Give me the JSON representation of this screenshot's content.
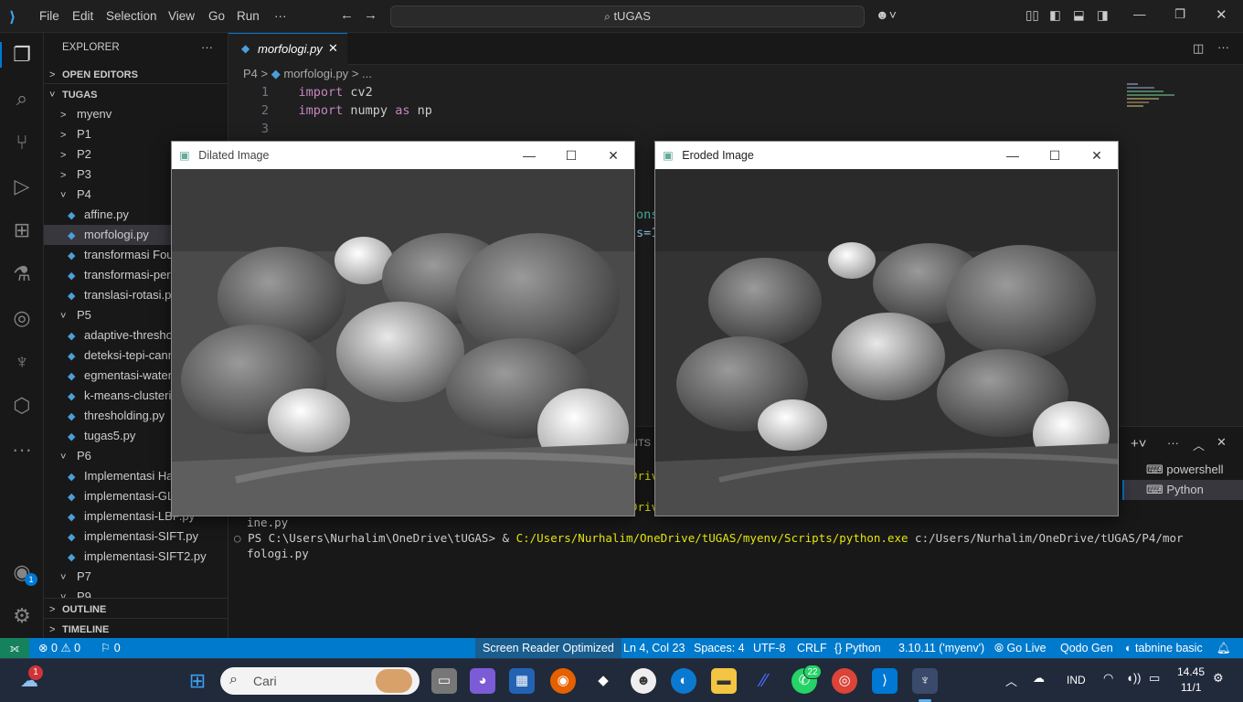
{
  "titlebar": {
    "menu": [
      "File",
      "Edit",
      "Selection",
      "View",
      "Go",
      "Run"
    ],
    "more": "···",
    "search": "tUGAS"
  },
  "sidebar": {
    "title": "EXPLORER",
    "more": "···",
    "open_editors": "OPEN EDITORS",
    "workspace": "TUGAS",
    "tree": [
      {
        "label": "myenv",
        "type": "folder",
        "depth": 1
      },
      {
        "label": "P1",
        "type": "folder",
        "depth": 1
      },
      {
        "label": "P2",
        "type": "folder",
        "depth": 1
      },
      {
        "label": "P3",
        "type": "folder",
        "depth": 1
      },
      {
        "label": "P4",
        "type": "folder-open",
        "depth": 1
      },
      {
        "label": "affine.py",
        "type": "file",
        "depth": 2
      },
      {
        "label": "morfologi.py",
        "type": "file",
        "depth": 2,
        "selected": true
      },
      {
        "label": "transformasi Fourier.py",
        "type": "file",
        "depth": 2
      },
      {
        "label": "transformasi-perspektif.py",
        "type": "file",
        "depth": 2
      },
      {
        "label": "translasi-rotasi.py",
        "type": "file",
        "depth": 2
      },
      {
        "label": "P5",
        "type": "folder-open",
        "depth": 1
      },
      {
        "label": "adaptive-thresholding.py",
        "type": "file",
        "depth": 2
      },
      {
        "label": "deteksi-tepi-canny.py",
        "type": "file",
        "depth": 2
      },
      {
        "label": "egmentasi-watershed.py",
        "type": "file",
        "depth": 2
      },
      {
        "label": "k-means-clustering.py",
        "type": "file",
        "depth": 2
      },
      {
        "label": "thresholding.py",
        "type": "file",
        "depth": 2
      },
      {
        "label": "tugas5.py",
        "type": "file",
        "depth": 2
      },
      {
        "label": "P6",
        "type": "folder-open",
        "depth": 1
      },
      {
        "label": "Implementasi Harris.py",
        "type": "file",
        "depth": 2
      },
      {
        "label": "implementasi-GLCM.py",
        "type": "file",
        "depth": 2
      },
      {
        "label": "implementasi-LBP.py",
        "type": "file",
        "depth": 2
      },
      {
        "label": "implementasi-SIFT.py",
        "type": "file",
        "depth": 2
      },
      {
        "label": "implementasi-SIFT2.py",
        "type": "file",
        "depth": 2
      },
      {
        "label": "P7",
        "type": "folder-open",
        "depth": 1
      },
      {
        "label": "P9",
        "type": "folder-open",
        "depth": 1
      }
    ],
    "outline": "OUTLINE",
    "timeline": "TIMELINE"
  },
  "editor": {
    "tab": "morfologi.py",
    "breadcrumb": [
      "P4",
      ">",
      "morfologi.py",
      ">",
      "..."
    ],
    "lines": [
      {
        "n": "1",
        "kw": "import",
        "rest": " cv2"
      },
      {
        "n": "2",
        "kw": "import",
        "rest": " numpy ",
        "kw2": "as",
        "rest2": " np"
      },
      {
        "n": "3",
        "kw": "",
        "rest": ""
      }
    ],
    "fragments": {
      "a": "ons",
      "b": "s=1"
    }
  },
  "panel": {
    "tab_partial": "NTS",
    "path_frag": "Driv",
    "line1": "ine.py",
    "prompt": "PS C:\\Users\\Nurhalim\\OneDrive\\tUGAS> & ",
    "cmd": "C:/Users/Nurhalim/OneDrive/tUGAS/myenv/Scripts/python.exe",
    "arg": " c:/Users/Nurhalim/OneDrive/tUGAS/P4/mor",
    "line3": "fologi.py",
    "terminals": [
      "powershell",
      "Python"
    ]
  },
  "windows": [
    {
      "title": "Dilated Image"
    },
    {
      "title": "Eroded Image"
    }
  ],
  "statusbar": {
    "errors": "0",
    "warnings": "0",
    "ports": "0",
    "items": [
      "Screen Reader Optimized",
      "Ln 4, Col 23",
      "Spaces: 4",
      "UTF-8",
      "CRLF",
      "{} Python",
      "3.10.11 ('myenv')",
      "Go Live",
      "Qodo Gen",
      "tabnine basic"
    ]
  },
  "taskbar": {
    "search": "Cari",
    "notif": "1",
    "whatsapp_badge": "22",
    "lang": "IND",
    "time": "14.45",
    "date": "11/1",
    "account_badge": "1"
  },
  "colors": {
    "accent": "#007acc",
    "bg": "#1f1f1f",
    "sidebar": "#181818"
  }
}
